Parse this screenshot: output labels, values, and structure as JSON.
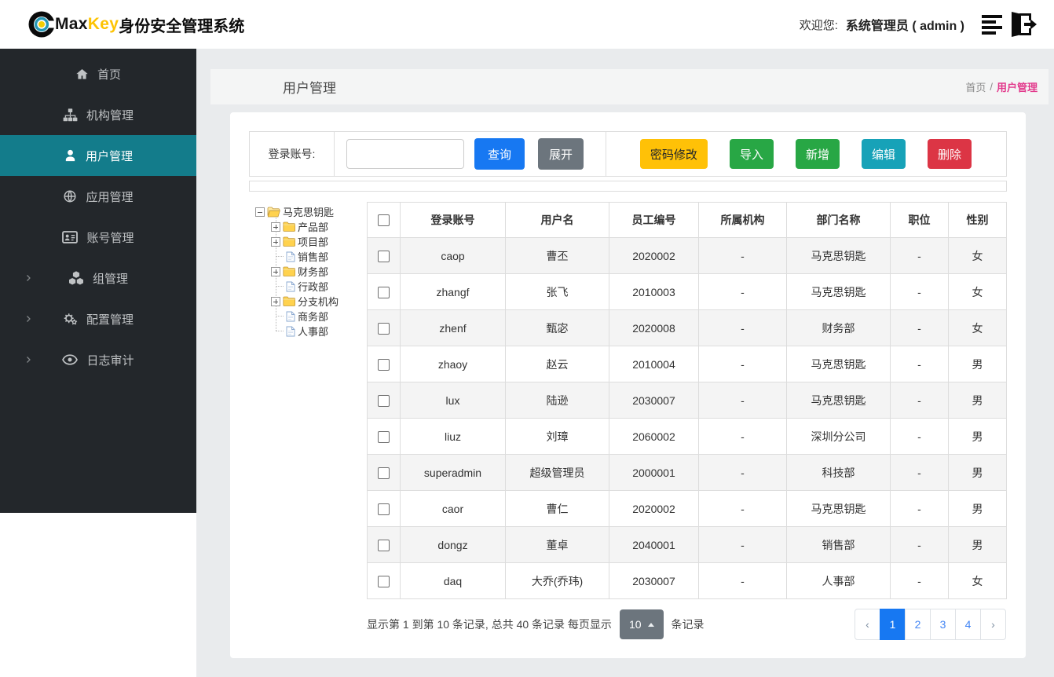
{
  "brand": {
    "max": "Max",
    "key": "Key",
    "title": "身份安全管理系统"
  },
  "header": {
    "welcome": "欢迎您:",
    "user": "系统管理员 ( admin )"
  },
  "colors": {
    "sidebar_bg": "#23272b",
    "accent_teal": "#137c8b",
    "primary_blue": "#1778f2",
    "link_blue": "#4285f4",
    "success_green": "#28a745",
    "warning_yellow": "#ffc107",
    "info_teal": "#17a2b8",
    "danger_red": "#dc3545",
    "breadcrumb_pink": "#e23a8c",
    "brand_gold": "#fdc303",
    "content_bg": "#e9ebed"
  },
  "sidebar": {
    "items": [
      {
        "key": "home",
        "label": "首页",
        "icon": "home",
        "active": false,
        "expandable": false
      },
      {
        "key": "org",
        "label": "机构管理",
        "icon": "sitemap",
        "active": false,
        "expandable": false
      },
      {
        "key": "user",
        "label": "用户管理",
        "icon": "user",
        "active": true,
        "expandable": false
      },
      {
        "key": "app",
        "label": "应用管理",
        "icon": "globe",
        "active": false,
        "expandable": false
      },
      {
        "key": "account",
        "label": "账号管理",
        "icon": "idcard",
        "active": false,
        "expandable": false
      },
      {
        "key": "group",
        "label": "组管理",
        "icon": "cubes",
        "active": false,
        "expandable": true
      },
      {
        "key": "config",
        "label": "配置管理",
        "icon": "gears",
        "active": false,
        "expandable": true
      },
      {
        "key": "audit",
        "label": "日志审计",
        "icon": "eye",
        "active": false,
        "expandable": true
      }
    ]
  },
  "page": {
    "title": "用户管理"
  },
  "breadcrumb": {
    "home": "首页",
    "separator": "/",
    "current": "用户管理"
  },
  "search": {
    "label": "登录账号:",
    "input_value": "",
    "query_button": "查询",
    "expand_button": "展开"
  },
  "actions": [
    {
      "key": "change-password",
      "label": "密码修改",
      "bg": "#ffc107",
      "fg": "#212529"
    },
    {
      "key": "import",
      "label": "导入",
      "bg": "#28a745",
      "fg": "#ffffff"
    },
    {
      "key": "add",
      "label": "新增",
      "bg": "#28a745",
      "fg": "#ffffff"
    },
    {
      "key": "edit",
      "label": "编辑",
      "bg": "#17a2b8",
      "fg": "#ffffff"
    },
    {
      "key": "delete",
      "label": "删除",
      "bg": "#dc3545",
      "fg": "#ffffff"
    }
  ],
  "tree": {
    "root": {
      "label": "马克思钥匙",
      "type": "folder-open",
      "switch": "minus"
    },
    "children": [
      {
        "label": "产品部",
        "type": "folder",
        "switch": "plus"
      },
      {
        "label": "项目部",
        "type": "folder",
        "switch": "plus"
      },
      {
        "label": "销售部",
        "type": "file",
        "switch": null
      },
      {
        "label": "财务部",
        "type": "folder",
        "switch": "plus"
      },
      {
        "label": "行政部",
        "type": "file",
        "switch": null
      },
      {
        "label": "分支机构",
        "type": "folder",
        "switch": "plus"
      },
      {
        "label": "商务部",
        "type": "file",
        "switch": null
      },
      {
        "label": "人事部",
        "type": "file",
        "switch": null
      }
    ]
  },
  "table": {
    "column_keys": [
      "login-account",
      "username",
      "employee-no",
      "organization",
      "department",
      "position",
      "gender"
    ],
    "columns": [
      "登录账号",
      "用户名",
      "员工编号",
      "所属机构",
      "部门名称",
      "职位",
      "性别"
    ],
    "rows": [
      [
        "caop",
        "曹丕",
        "2020002",
        "-",
        "马克思钥匙",
        "-",
        "女"
      ],
      [
        "zhangf",
        "张飞",
        "2010003",
        "-",
        "马克思钥匙",
        "-",
        "女"
      ],
      [
        "zhenf",
        "甄宓",
        "2020008",
        "-",
        "财务部",
        "-",
        "女"
      ],
      [
        "zhaoy",
        "赵云",
        "2010004",
        "-",
        "马克思钥匙",
        "-",
        "男"
      ],
      [
        "lux",
        "陆逊",
        "2030007",
        "-",
        "马克思钥匙",
        "-",
        "男"
      ],
      [
        "liuz",
        "刘璋",
        "2060002",
        "-",
        "深圳分公司",
        "-",
        "男"
      ],
      [
        "superadmin",
        "超级管理员",
        "2000001",
        "-",
        "科技部",
        "-",
        "男"
      ],
      [
        "caor",
        "曹仁",
        "2020002",
        "-",
        "马克思钥匙",
        "-",
        "男"
      ],
      [
        "dongz",
        "董卓",
        "2040001",
        "-",
        "销售部",
        "-",
        "男"
      ],
      [
        "daq",
        "大乔(乔玮)",
        "2030007",
        "-",
        "人事部",
        "-",
        "女"
      ]
    ]
  },
  "pagination": {
    "info_before": "显示第 1 到第 10 条记录, 总共 40 条记录 每页显示",
    "page_size": "10",
    "info_after": "条记录",
    "pages": [
      {
        "label": "‹",
        "type": "prev",
        "active": false
      },
      {
        "label": "1",
        "type": "page",
        "active": true
      },
      {
        "label": "2",
        "type": "page",
        "active": false
      },
      {
        "label": "3",
        "type": "page",
        "active": false
      },
      {
        "label": "4",
        "type": "page",
        "active": false
      },
      {
        "label": "›",
        "type": "next",
        "active": false
      }
    ]
  }
}
